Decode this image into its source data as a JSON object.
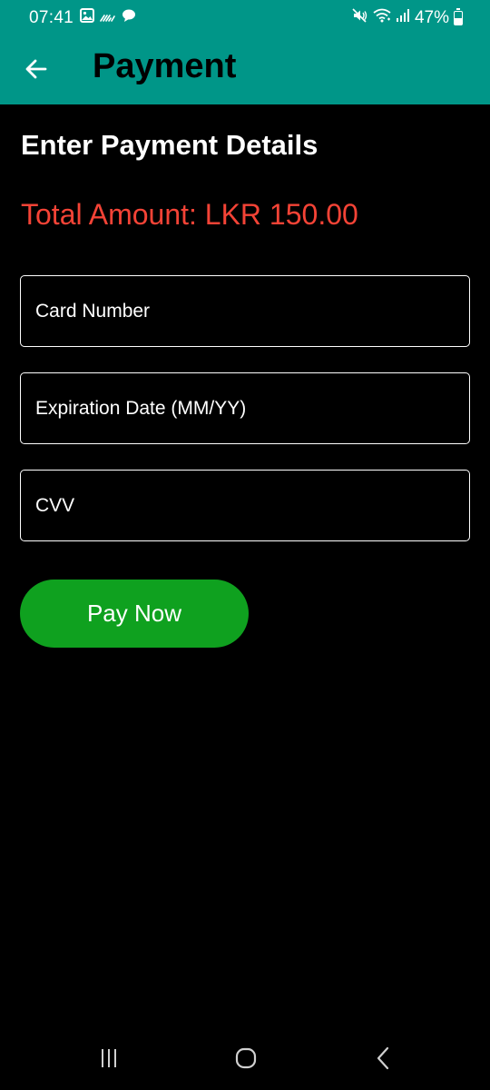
{
  "status_bar": {
    "time": "07:41",
    "battery": "47%",
    "battery_level": 0.47,
    "left_icons": [
      "image-icon",
      "wave-icon",
      "chat-bubble-icon"
    ],
    "right_icons": [
      "mute-icon",
      "wifi-icon",
      "signal-icon",
      "battery-icon"
    ]
  },
  "header": {
    "title": "Payment",
    "back_icon": "back-arrow-icon",
    "background_color": "#009688",
    "title_color": "#000000"
  },
  "main": {
    "heading": "Enter Payment Details",
    "total_amount": "Total Amount: LKR 150.00",
    "total_amount_color": "#f44336",
    "fields": {
      "card_number": {
        "value": "",
        "placeholder": "Card Number"
      },
      "expiration_date": {
        "value": "",
        "placeholder": "Expiration Date (MM/YY)"
      },
      "cvv": {
        "value": "",
        "placeholder": "CVV"
      }
    },
    "pay_button": {
      "label": "Pay Now",
      "color": "#0fa11f"
    }
  },
  "nav_bar": {
    "buttons": [
      "recent-apps-icon",
      "home-icon",
      "back-icon"
    ]
  }
}
